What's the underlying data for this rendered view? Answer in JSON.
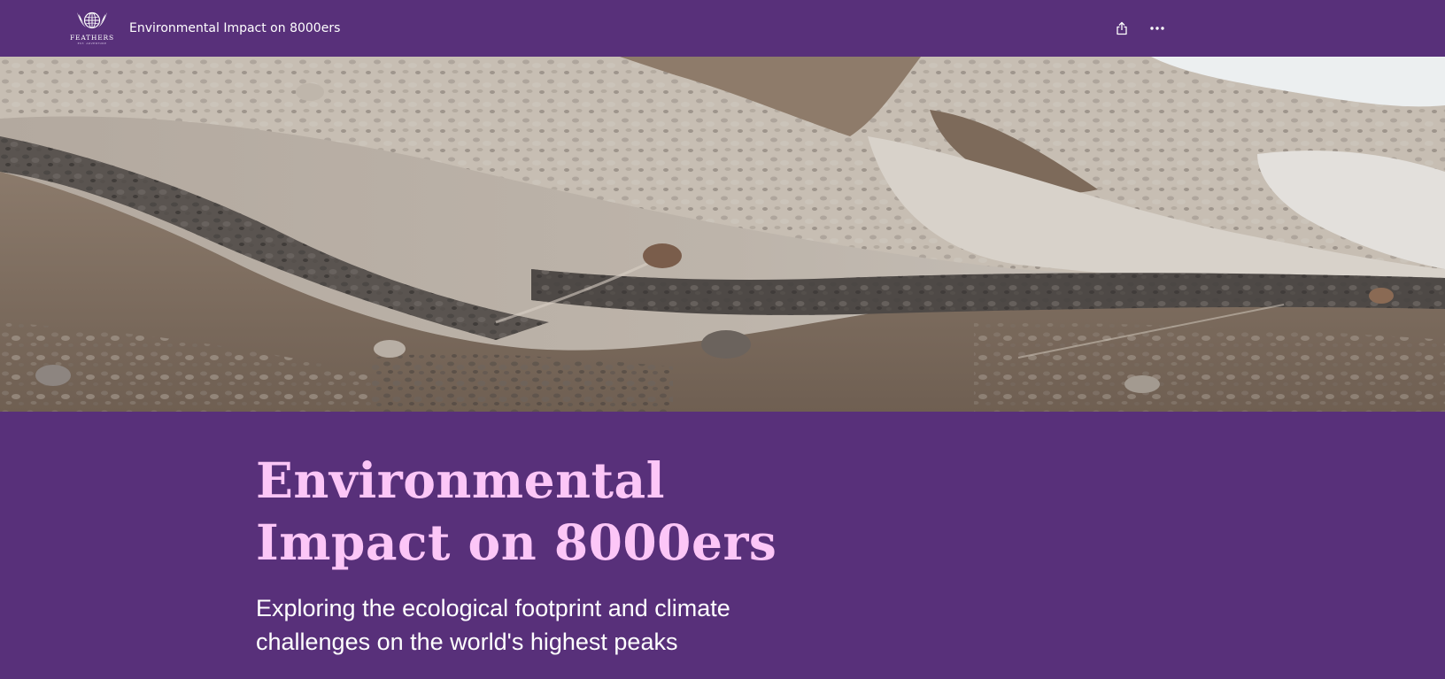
{
  "header": {
    "logo_text": "FEATHERS",
    "logo_subtext": "EST. ADVENTURE",
    "title": "Environmental Impact on 8000ers",
    "share_icon": "share-icon",
    "more_icon": "more-horizontal-icon"
  },
  "hero": {
    "image_description_icon": "mountain-scree-photo"
  },
  "story": {
    "title_line1": "Environmental",
    "title_line2": "Impact on 8000ers",
    "subtitle": "Exploring the ecological footprint and climate challenges on the world's highest peaks"
  },
  "colors": {
    "brand_purple": "#58307a",
    "title_pink": "#fcc6f7",
    "text_white": "#ffffff"
  }
}
